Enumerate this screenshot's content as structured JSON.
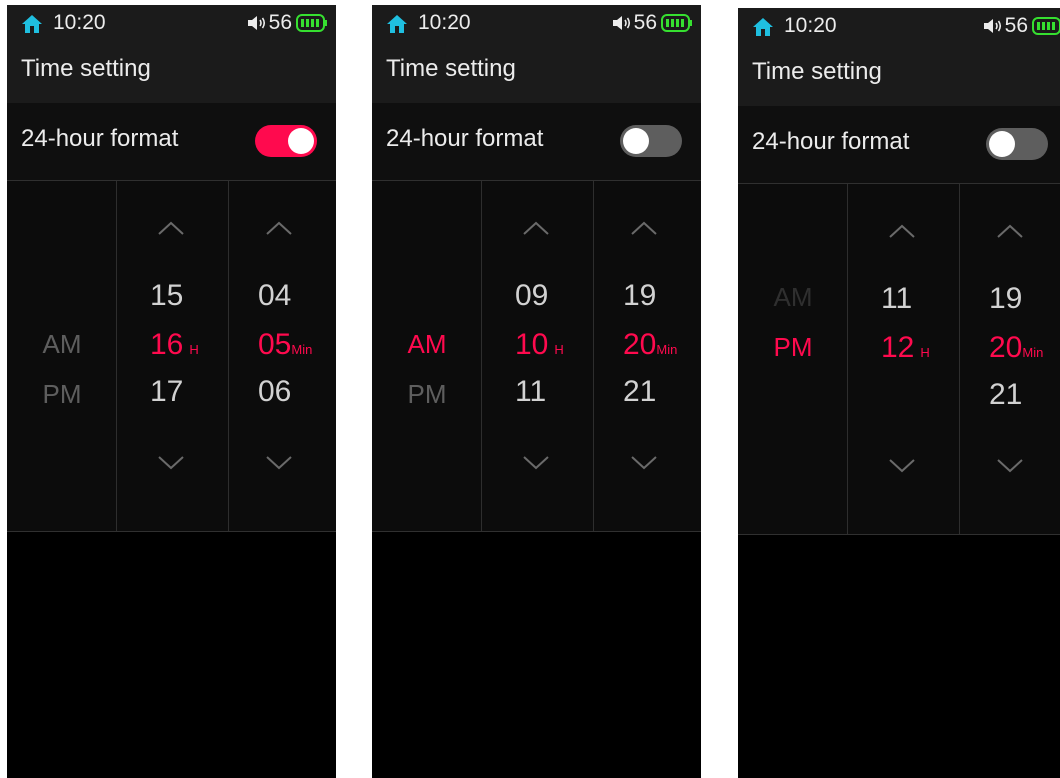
{
  "colors": {
    "accent": "#ff0a4e",
    "home_icon": "#1fbfe0",
    "battery": "#36e030"
  },
  "icons": [
    "home-icon",
    "volume-icon",
    "battery-icon",
    "chevron-up-icon",
    "chevron-down-icon"
  ],
  "screens": [
    {
      "status": {
        "time": "10:20",
        "volume": "56"
      },
      "title": "Time setting",
      "setting": {
        "label": "24-hour format",
        "enabled": true
      },
      "ampm": [
        {
          "text": "AM",
          "state": "normal"
        },
        {
          "text": "PM",
          "state": "normal"
        }
      ],
      "hour": {
        "prev": "15",
        "current": "16",
        "next": "17",
        "unit": "H"
      },
      "minute": {
        "prev": "04",
        "current": "05",
        "next": "06",
        "unit": "Min"
      }
    },
    {
      "status": {
        "time": "10:20",
        "volume": "56"
      },
      "title": "Time setting",
      "setting": {
        "label": "24-hour format",
        "enabled": false
      },
      "ampm": [
        {
          "text": "AM",
          "state": "selected"
        },
        {
          "text": "PM",
          "state": "normal"
        }
      ],
      "hour": {
        "prev": "09",
        "current": "10",
        "next": "11",
        "unit": "H"
      },
      "minute": {
        "prev": "19",
        "current": "20",
        "next": "21",
        "unit": "Min"
      }
    },
    {
      "status": {
        "time": "10:20",
        "volume": "56"
      },
      "title": "Time setting",
      "setting": {
        "label": "24-hour format",
        "enabled": false
      },
      "ampm": [
        {
          "text": "AM",
          "state": "dim"
        },
        {
          "text": "PM",
          "state": "selected"
        }
      ],
      "hour": {
        "prev": "11",
        "current": "12",
        "next": "",
        "unit": "H"
      },
      "minute": {
        "prev": "19",
        "current": "20",
        "next": "21",
        "unit": "Min"
      }
    }
  ]
}
